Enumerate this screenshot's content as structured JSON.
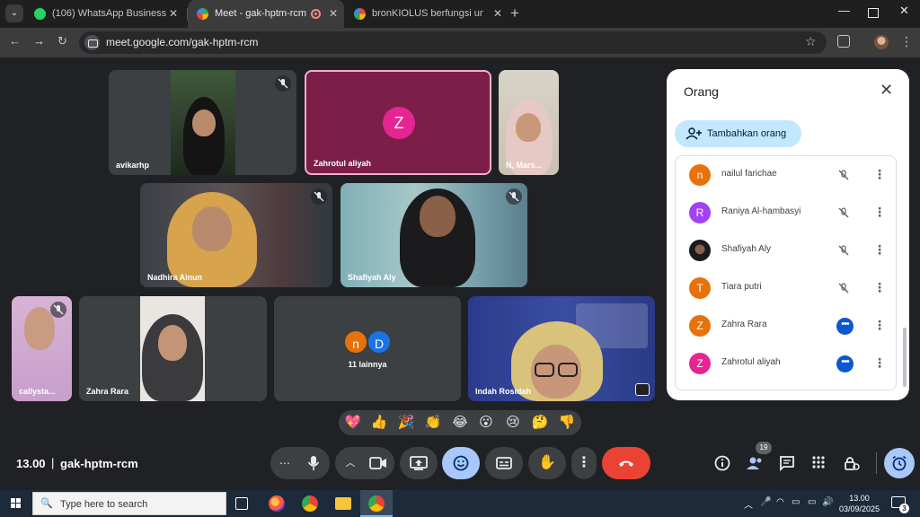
{
  "browser": {
    "tabs": [
      {
        "title": "(106) WhatsApp Business",
        "active": false
      },
      {
        "title": "Meet - gak-hptm-rcm",
        "active": true
      },
      {
        "title": "bronKIOLUS berfungsi untuk - I",
        "active": false
      }
    ],
    "url": "meet.google.com/gak-hptm-rcm"
  },
  "tiles": {
    "t1": "avikarhp",
    "t2": "Zahrotul aliyah",
    "t2_initial": "Z",
    "t3": "N, Mars...",
    "t4": "Nadhira Ainun",
    "t5": "Shafiyah Aly",
    "t6": "callysta...",
    "t7": "Zahra Rara",
    "others_label": "11 lainnya",
    "others_initials": [
      "n",
      "D"
    ],
    "t9": "Indah Rosidah"
  },
  "panel": {
    "title": "Orang",
    "add_label": "Tambahkan orang",
    "participants": [
      {
        "initial": "n",
        "name": "nailul farichae",
        "color": "#e8710a",
        "state": "muted"
      },
      {
        "initial": "R",
        "name": "Raniya Al-hambasyi",
        "color": "#a142f4",
        "state": "muted"
      },
      {
        "initial": "",
        "name": "Shafiyah Aly",
        "color": "#202124",
        "state": "muted"
      },
      {
        "initial": "T",
        "name": "Tiara putri",
        "color": "#e8710a",
        "state": "muted"
      },
      {
        "initial": "Z",
        "name": "Zahra Rara",
        "color": "#e8710a",
        "state": "speaking"
      },
      {
        "initial": "Z",
        "name": "Zahrotul aliyah",
        "color": "#e52592",
        "state": "speaking"
      }
    ]
  },
  "reactions": [
    "💖",
    "👍",
    "🎉",
    "👏",
    "😂",
    "😮",
    "😢",
    "🤔",
    "👎"
  ],
  "bottom": {
    "time": "13.00",
    "separator": "|",
    "meeting_code": "gak-hptm-rcm",
    "participant_count": "19"
  },
  "taskbar": {
    "search_placeholder": "Type here to search",
    "time": "13.00",
    "date": "03/09/2025",
    "notifications": "3"
  },
  "colors": {
    "meet_bg": "#202124",
    "tile_bg": "#3c4043",
    "end_call": "#ea4335",
    "accent_blue": "#a8c7fa",
    "add_button": "#c2e7ff"
  }
}
